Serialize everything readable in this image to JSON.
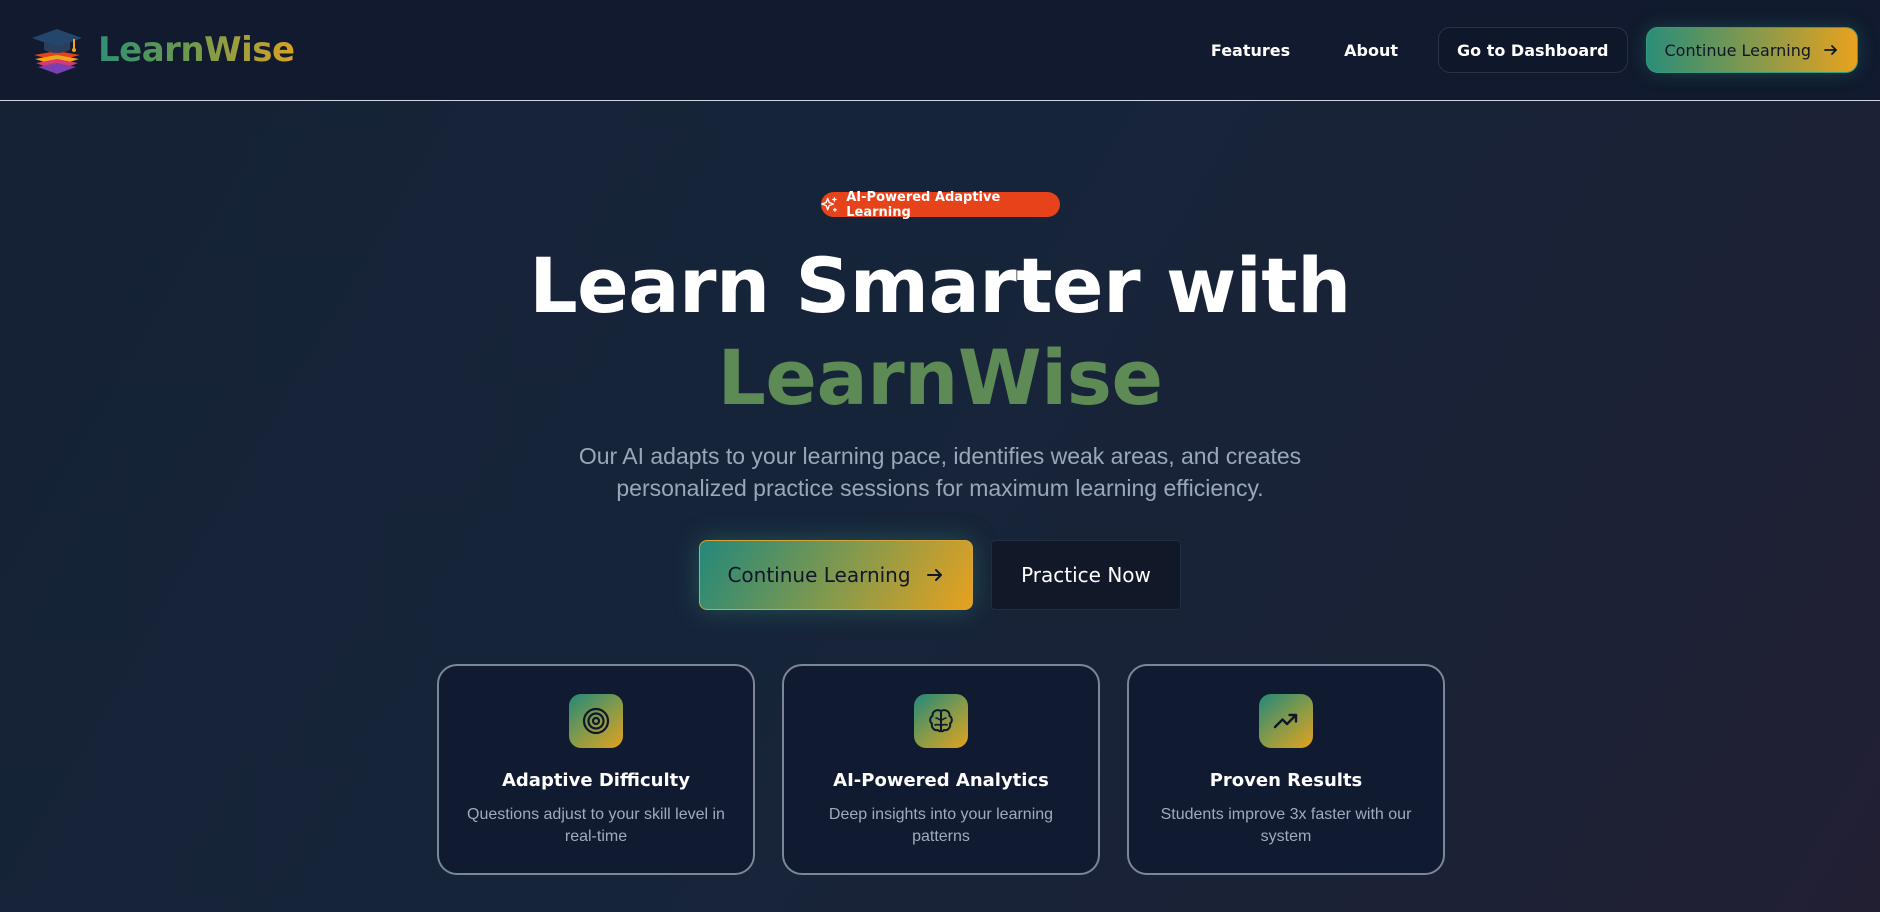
{
  "header": {
    "brand": "LearnWise",
    "nav": {
      "features": "Features",
      "about": "About",
      "dashboard": "Go to Dashboard",
      "continue": "Continue Learning"
    }
  },
  "hero": {
    "badge": "AI-Powered Adaptive Learning",
    "title_line1": "Learn Smarter with",
    "title_line2": "LearnWise",
    "subtitle": "Our AI adapts to your learning pace, identifies weak areas, and creates personalized practice sessions for maximum learning efficiency.",
    "primary_cta": "Continue Learning",
    "secondary_cta": "Practice Now"
  },
  "features": [
    {
      "icon": "target-icon",
      "title": "Adaptive Difficulty",
      "description": "Questions adjust to your skill level in real-time"
    },
    {
      "icon": "brain-icon",
      "title": "AI-Powered Analytics",
      "description": "Deep insights into your learning patterns"
    },
    {
      "icon": "trending-up-icon",
      "title": "Proven Results",
      "description": "Students improve 3x faster with our system"
    }
  ],
  "colors": {
    "background": "#152235",
    "header": "#111a2e",
    "badge": "#e6431b",
    "accent_green": "#5d8a55",
    "gradient_start": "#23887a",
    "gradient_end": "#e7a11f",
    "card_bg": "#101a30",
    "muted_text": "#9aa7bb"
  }
}
